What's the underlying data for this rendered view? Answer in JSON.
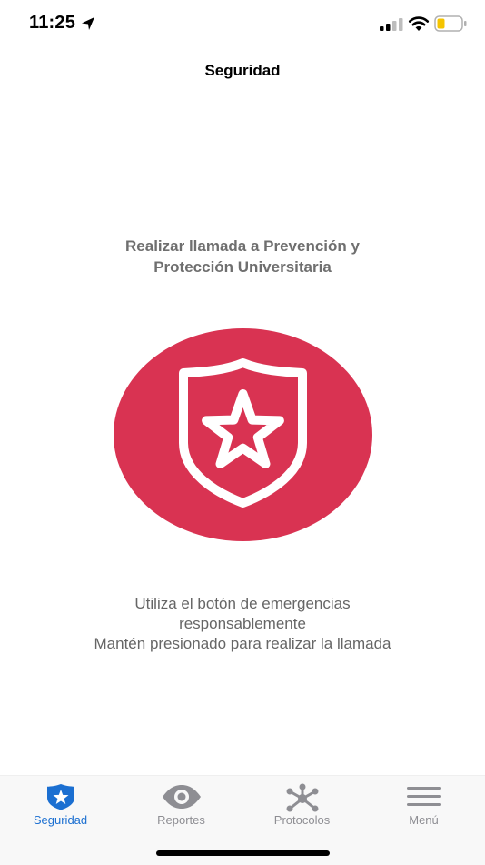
{
  "status_bar": {
    "time": "11:25",
    "icons": [
      "location-arrow-icon",
      "cellular-signal-icon",
      "wifi-icon",
      "battery-low-icon"
    ]
  },
  "header": {
    "title": "Seguridad"
  },
  "main": {
    "heading_line1": "Realizar llamada a Prevención y",
    "heading_line2": "Protección Universitaria",
    "emergency_button_icon": "shield-star-icon",
    "instruction_line1": "Utiliza el botón de emergencias",
    "instruction_line2": "responsablemente",
    "instruction_line3": "Mantén presionado para realizar la llamada"
  },
  "tab_bar": {
    "active": "Seguridad",
    "tabs": [
      {
        "label": "Seguridad",
        "icon": "shield-star-icon"
      },
      {
        "label": "Reportes",
        "icon": "eye-icon"
      },
      {
        "label": "Protocolos",
        "icon": "network-nodes-icon"
      },
      {
        "label": "Menú",
        "icon": "hamburger-menu-icon"
      }
    ]
  },
  "colors": {
    "accent_red": "#d93352",
    "active_tab_blue": "#1b6fd1",
    "inactive_gray": "#8e8e93",
    "battery_yellow": "#f5c400"
  }
}
